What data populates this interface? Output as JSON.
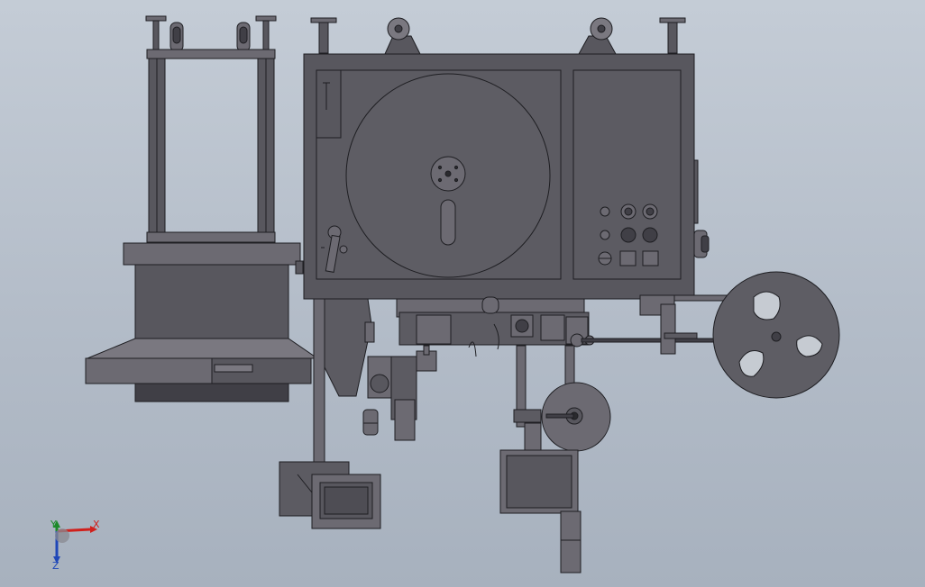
{
  "viewport": {
    "background_top": "#c4ccd6",
    "background_bottom": "#a7b1be"
  },
  "model": {
    "body_color": "#58575e",
    "body_color_light": "#6c6a72",
    "body_color_dark": "#403f46",
    "edge_color": "#1e1e22"
  },
  "triad": {
    "x_label": "X",
    "y_label": "Y",
    "z_label": "Z",
    "x_color": "#d0201c",
    "y_color": "#1d8a2a",
    "z_color": "#1f47b8"
  }
}
